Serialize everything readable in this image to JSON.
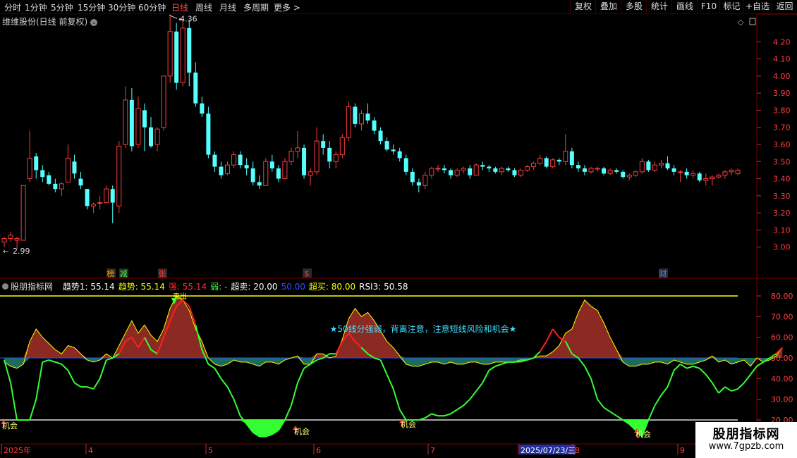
{
  "toolbar": {
    "timeframes": [
      "分时",
      "1分钟",
      "5分钟",
      "15分钟",
      "30分钟",
      "60分钟",
      "日线",
      "周线",
      "月线",
      "多周期",
      "更多 >"
    ],
    "active_timeframe": "日线",
    "right_buttons": [
      "复权",
      "叠加",
      "多股",
      "统计",
      "画线",
      "F10",
      "标记",
      "+自选",
      "返回"
    ]
  },
  "main_chart": {
    "title": "维维股份(日线 前复权)",
    "price_axis": [
      "4.20",
      "4.10",
      "4.00",
      "3.90",
      "3.80",
      "3.70",
      "3.60",
      "3.50",
      "3.40",
      "3.30",
      "3.20",
      "3.10",
      "3.00"
    ],
    "high_label": "4.36",
    "low_label": "2.99",
    "event_markers": [
      {
        "text": "榜",
        "color": "#ffa000"
      },
      {
        "text": "减",
        "color": "#40ff40"
      },
      {
        "text": "张",
        "color": "#ff4040"
      },
      {
        "text": "$",
        "color": "#ff4040"
      },
      {
        "text": "财",
        "color": "#5080ff"
      }
    ]
  },
  "indicator": {
    "name": "股朋指标网",
    "values": [
      {
        "label": "趋势1: 55.14",
        "color": "#ffffff"
      },
      {
        "label": "趋势: 55.14",
        "color": "#ffff00"
      },
      {
        "label": "强: 55.14",
        "color": "#ff3030"
      },
      {
        "label": "弱: -",
        "color": "#40ff40"
      },
      {
        "label": "超卖: 20.00",
        "color": "#ffffff"
      },
      {
        "label": "50.00",
        "color": "#3050ff"
      },
      {
        "label": "超买: 80.00",
        "color": "#ffff00"
      },
      {
        "label": "RSI3: 50.58",
        "color": "#ffffff"
      }
    ],
    "axis": [
      "80.00",
      "70.00",
      "60.00",
      "50.00",
      "40.00",
      "30.00",
      "20.00"
    ],
    "annotation": "★50线分强弱，背离注意，注意短线风险和机会★",
    "opportunity_label": "机会",
    "top_label": "卖出",
    "overbought": 80,
    "oversold": 20,
    "mid": 50
  },
  "date_axis": {
    "labels": [
      "2025年",
      "4",
      "5",
      "6",
      "7",
      "2025/07/23/三",
      "8",
      "9"
    ]
  },
  "watermark": {
    "line1": "股朋指标网",
    "line2": "www.7gpzb.com"
  },
  "colors": {
    "up": "#ff3c3c",
    "down": "#54ffff",
    "strong_fill": "#8b2a22",
    "weak_fill": "#1c6b5c",
    "oversold_fill": "#33ff33",
    "line_green": "#33ff33",
    "line_red": "#ff2020"
  },
  "chart_data": {
    "type": "candlestick",
    "ohlc": [
      [
        3.03,
        3.06,
        3.0,
        3.05
      ],
      [
        3.05,
        3.09,
        3.03,
        3.07
      ],
      [
        3.04,
        3.06,
        2.99,
        3.05
      ],
      [
        3.04,
        3.36,
        3.04,
        3.36
      ],
      [
        3.4,
        3.68,
        3.38,
        3.52
      ],
      [
        3.53,
        3.55,
        3.4,
        3.45
      ],
      [
        3.45,
        3.48,
        3.38,
        3.41
      ],
      [
        3.42,
        3.44,
        3.36,
        3.37
      ],
      [
        3.37,
        3.4,
        3.32,
        3.34
      ],
      [
        3.34,
        3.38,
        3.3,
        3.37
      ],
      [
        3.38,
        3.6,
        3.38,
        3.52
      ],
      [
        3.5,
        3.54,
        3.4,
        3.43
      ],
      [
        3.4,
        3.44,
        3.34,
        3.36
      ],
      [
        3.34,
        3.34,
        3.22,
        3.24
      ],
      [
        3.24,
        3.26,
        3.2,
        3.25
      ],
      [
        3.26,
        3.3,
        3.22,
        3.26
      ],
      [
        3.26,
        3.36,
        3.26,
        3.34
      ],
      [
        3.34,
        3.36,
        3.14,
        3.26
      ],
      [
        3.24,
        3.62,
        3.2,
        3.59
      ],
      [
        3.6,
        3.94,
        3.58,
        3.86
      ],
      [
        3.86,
        3.93,
        3.56,
        3.59
      ],
      [
        3.6,
        3.88,
        3.58,
        3.81
      ],
      [
        3.8,
        3.84,
        3.56,
        3.7
      ],
      [
        3.7,
        3.76,
        3.58,
        3.59
      ],
      [
        3.6,
        3.7,
        3.56,
        3.69
      ],
      [
        3.7,
        3.99,
        3.68,
        4.0
      ],
      [
        4.0,
        4.36,
        3.96,
        4.26
      ],
      [
        4.26,
        4.31,
        3.92,
        3.96
      ],
      [
        3.96,
        4.33,
        3.94,
        4.28
      ],
      [
        4.28,
        4.33,
        3.94,
        4.02
      ],
      [
        4.02,
        4.08,
        3.82,
        3.84
      ],
      [
        3.84,
        3.88,
        3.76,
        3.78
      ],
      [
        3.78,
        3.82,
        3.52,
        3.54
      ],
      [
        3.54,
        3.56,
        3.44,
        3.47
      ],
      [
        3.47,
        3.5,
        3.4,
        3.42
      ],
      [
        3.43,
        3.5,
        3.42,
        3.48
      ],
      [
        3.48,
        3.56,
        3.46,
        3.54
      ],
      [
        3.54,
        3.56,
        3.46,
        3.48
      ],
      [
        3.48,
        3.52,
        3.42,
        3.46
      ],
      [
        3.46,
        3.5,
        3.36,
        3.38
      ],
      [
        3.38,
        3.42,
        3.34,
        3.36
      ],
      [
        3.36,
        3.52,
        3.36,
        3.5
      ],
      [
        3.5,
        3.54,
        3.44,
        3.46
      ],
      [
        3.46,
        3.48,
        3.38,
        3.4
      ],
      [
        3.4,
        3.52,
        3.4,
        3.5
      ],
      [
        3.5,
        3.58,
        3.48,
        3.56
      ],
      [
        3.56,
        3.68,
        3.52,
        3.58
      ],
      [
        3.58,
        3.6,
        3.4,
        3.42
      ],
      [
        3.42,
        3.46,
        3.36,
        3.44
      ],
      [
        3.44,
        3.7,
        3.42,
        3.62
      ],
      [
        3.62,
        3.66,
        3.54,
        3.58
      ],
      [
        3.58,
        3.62,
        3.46,
        3.5
      ],
      [
        3.5,
        3.56,
        3.46,
        3.54
      ],
      [
        3.54,
        3.66,
        3.52,
        3.64
      ],
      [
        3.64,
        3.85,
        3.62,
        3.82
      ],
      [
        3.82,
        3.84,
        3.7,
        3.72
      ],
      [
        3.72,
        3.8,
        3.68,
        3.78
      ],
      [
        3.78,
        3.84,
        3.72,
        3.74
      ],
      [
        3.74,
        3.76,
        3.66,
        3.68
      ],
      [
        3.68,
        3.7,
        3.6,
        3.62
      ],
      [
        3.62,
        3.64,
        3.56,
        3.57
      ],
      [
        3.57,
        3.6,
        3.54,
        3.56
      ],
      [
        3.56,
        3.58,
        3.5,
        3.52
      ],
      [
        3.52,
        3.54,
        3.42,
        3.44
      ],
      [
        3.44,
        3.46,
        3.36,
        3.38
      ],
      [
        3.38,
        3.4,
        3.32,
        3.36
      ],
      [
        3.36,
        3.44,
        3.34,
        3.42
      ],
      [
        3.42,
        3.47,
        3.4,
        3.46
      ],
      [
        3.46,
        3.48,
        3.44,
        3.46
      ],
      [
        3.46,
        3.48,
        3.43,
        3.45
      ],
      [
        3.45,
        3.46,
        3.4,
        3.42
      ],
      [
        3.42,
        3.46,
        3.41,
        3.45
      ],
      [
        3.45,
        3.47,
        3.43,
        3.46
      ],
      [
        3.46,
        3.48,
        3.4,
        3.42
      ],
      [
        3.42,
        3.49,
        3.42,
        3.48
      ],
      [
        3.48,
        3.5,
        3.45,
        3.47
      ],
      [
        3.47,
        3.48,
        3.44,
        3.46
      ],
      [
        3.46,
        3.47,
        3.43,
        3.44
      ],
      [
        3.44,
        3.47,
        3.42,
        3.46
      ],
      [
        3.46,
        3.47,
        3.44,
        3.45
      ],
      [
        3.45,
        3.46,
        3.41,
        3.42
      ],
      [
        3.42,
        3.46,
        3.41,
        3.45
      ],
      [
        3.45,
        3.48,
        3.44,
        3.47
      ],
      [
        3.47,
        3.5,
        3.45,
        3.49
      ],
      [
        3.49,
        3.54,
        3.48,
        3.52
      ],
      [
        3.52,
        3.53,
        3.46,
        3.47
      ],
      [
        3.47,
        3.52,
        3.46,
        3.51
      ],
      [
        3.51,
        3.52,
        3.48,
        3.5
      ],
      [
        3.5,
        3.66,
        3.48,
        3.56
      ],
      [
        3.56,
        3.58,
        3.46,
        3.48
      ],
      [
        3.48,
        3.5,
        3.44,
        3.46
      ],
      [
        3.46,
        3.48,
        3.42,
        3.44
      ],
      [
        3.44,
        3.47,
        3.43,
        3.46
      ],
      [
        3.46,
        3.47,
        3.44,
        3.46
      ],
      [
        3.46,
        3.47,
        3.42,
        3.43
      ],
      [
        3.43,
        3.46,
        3.42,
        3.45
      ],
      [
        3.45,
        3.46,
        3.43,
        3.44
      ],
      [
        3.44,
        3.45,
        3.4,
        3.41
      ],
      [
        3.41,
        3.43,
        3.39,
        3.42
      ],
      [
        3.42,
        3.45,
        3.41,
        3.44
      ],
      [
        3.44,
        3.52,
        3.43,
        3.5
      ],
      [
        3.5,
        3.51,
        3.44,
        3.45
      ],
      [
        3.45,
        3.5,
        3.44,
        3.48
      ],
      [
        3.48,
        3.51,
        3.46,
        3.49
      ],
      [
        3.49,
        3.53,
        3.45,
        3.46
      ],
      [
        3.46,
        3.48,
        3.42,
        3.44
      ],
      [
        3.44,
        3.45,
        3.38,
        3.44
      ],
      [
        3.44,
        3.46,
        3.4,
        3.42
      ],
      [
        3.42,
        3.45,
        3.4,
        3.43
      ],
      [
        3.43,
        3.44,
        3.38,
        3.39
      ],
      [
        3.39,
        3.43,
        3.36,
        3.4
      ],
      [
        3.4,
        3.42,
        3.36,
        3.41
      ],
      [
        3.41,
        3.43,
        3.4,
        3.42
      ],
      [
        3.42,
        3.45,
        3.4,
        3.44
      ],
      [
        3.44,
        3.46,
        3.42,
        3.45
      ],
      [
        3.43,
        3.46,
        3.42,
        3.45
      ]
    ],
    "rsi3": [
      48,
      46,
      45,
      47,
      58,
      64,
      60,
      57,
      54,
      52,
      56,
      55,
      52,
      49,
      48,
      49,
      52,
      50,
      56,
      62,
      68,
      62,
      66,
      61,
      58,
      64,
      74,
      80,
      78,
      73,
      64,
      58,
      50,
      47,
      46,
      47,
      49,
      48,
      48,
      47,
      46,
      48,
      48,
      47,
      49,
      50,
      51,
      47,
      47,
      52,
      52,
      50,
      51,
      59,
      69,
      74,
      70,
      72,
      68,
      63,
      58,
      55,
      51,
      47,
      46,
      46,
      47,
      48,
      48,
      47,
      48,
      47,
      47,
      48,
      48,
      47,
      47,
      48,
      48,
      48,
      48,
      48,
      49,
      50,
      51,
      51,
      53,
      56,
      62,
      64,
      72,
      78,
      75,
      73,
      67,
      60,
      54,
      48,
      46,
      46,
      47,
      47,
      48,
      48,
      47,
      49,
      48,
      47,
      47,
      48,
      49,
      51,
      48,
      49,
      47,
      48,
      49,
      46,
      50,
      48,
      49,
      51,
      55
    ],
    "weak_line": [
      49,
      38,
      20,
      20,
      20,
      30,
      48,
      49,
      48,
      47,
      44,
      38,
      36,
      36,
      35,
      40,
      49,
      50,
      52,
      58,
      60,
      55,
      60,
      54,
      52,
      60,
      68,
      75,
      78,
      75,
      66,
      54,
      47,
      45,
      40,
      36,
      30,
      22,
      18,
      14,
      12,
      12,
      13,
      15,
      20,
      27,
      38,
      45,
      47,
      49,
      50,
      52,
      52,
      58,
      62,
      58,
      55,
      52,
      50,
      49,
      42,
      35,
      25,
      20,
      20,
      20,
      21,
      23,
      22,
      22,
      23,
      25,
      27,
      30,
      34,
      38,
      44,
      46,
      47,
      48,
      48,
      49,
      49,
      50,
      53,
      58,
      64,
      60,
      58,
      52,
      50,
      46,
      40,
      30,
      26,
      24,
      22,
      20,
      18,
      15,
      12,
      20,
      27,
      32,
      36,
      44,
      47,
      45,
      46,
      45,
      42,
      38,
      33,
      36,
      34,
      35,
      38,
      42,
      46,
      48,
      50,
      52,
      55
    ]
  }
}
